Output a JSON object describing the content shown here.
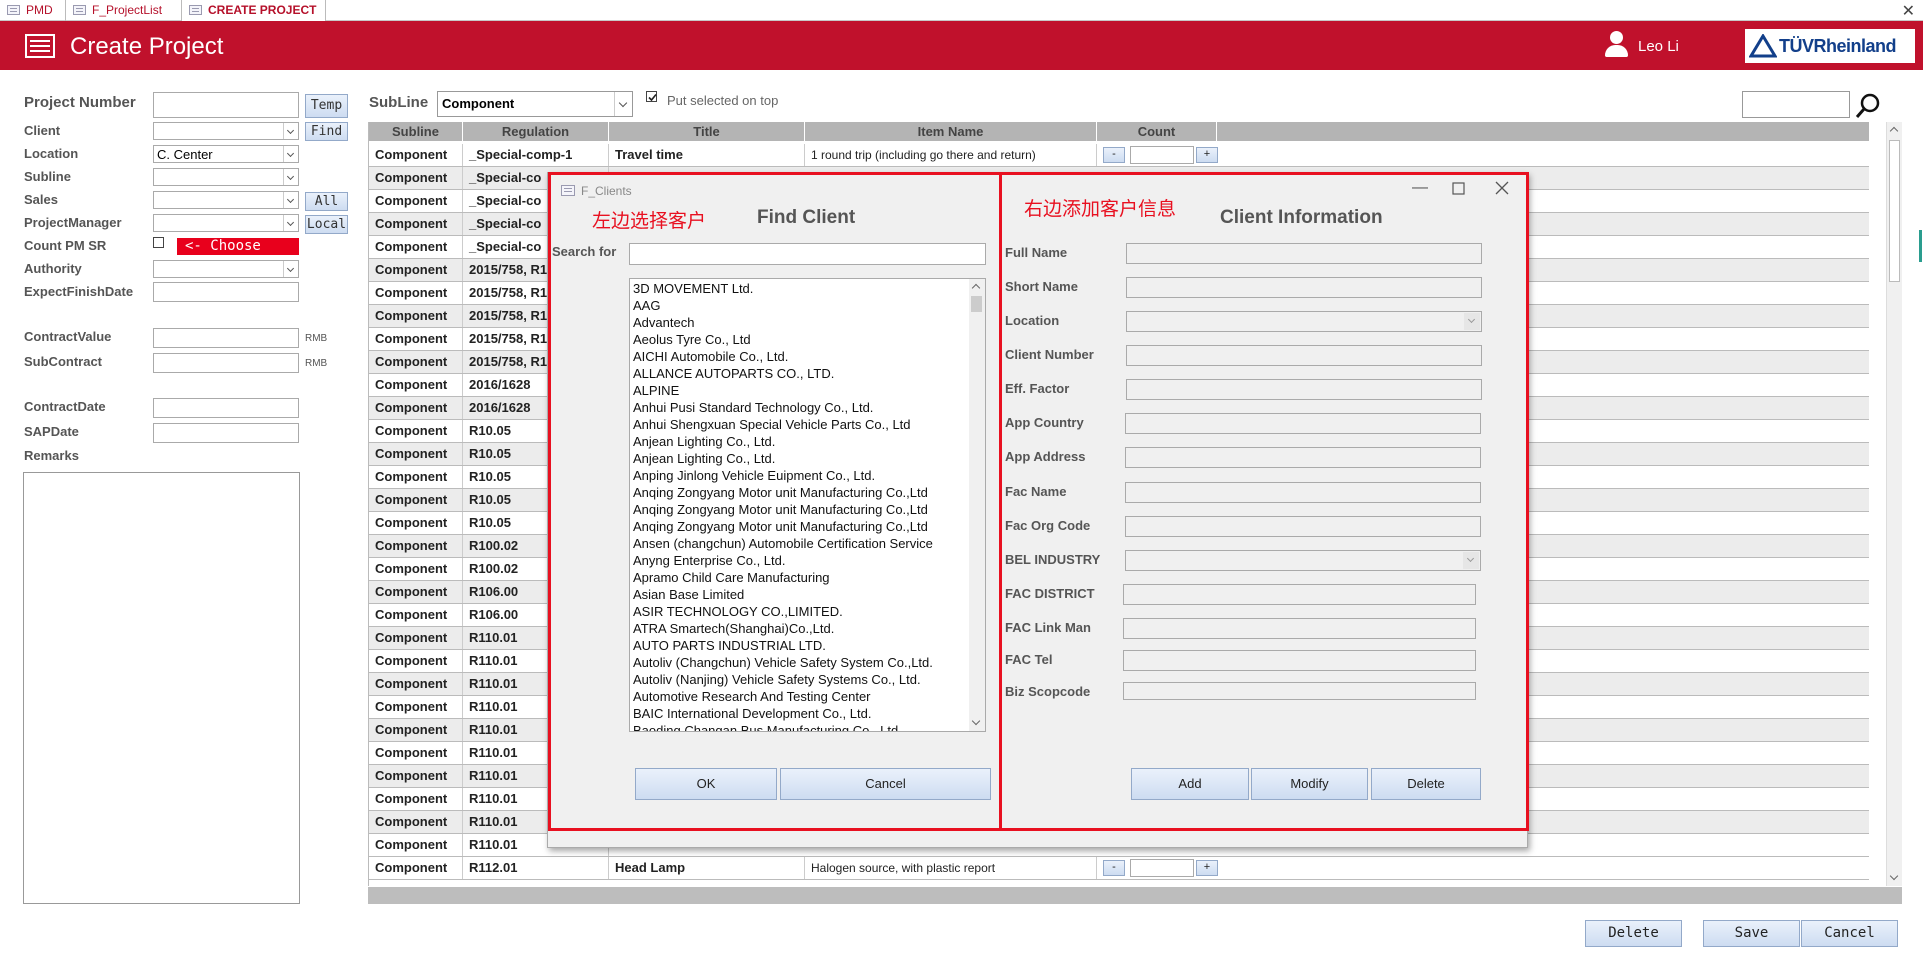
{
  "tabs": [
    {
      "label": "PMD"
    },
    {
      "label": "F_ProjectList"
    },
    {
      "label": "CREATE PROJECT"
    }
  ],
  "window": {
    "close_glyph": "✕"
  },
  "header": {
    "title": "Create Project",
    "user_name": "Leo Li",
    "logo_text": "TÜVRheinland"
  },
  "form": {
    "project_number_label": "Project Number",
    "client_label": "Client",
    "location_label": "Location",
    "location_value": "C. Center",
    "subline_label": "Subline",
    "sales_label": "Sales",
    "project_manager_label": "ProjectManager",
    "count_pm_sr_label": "Count PM SR",
    "authority_label": "Authority",
    "expect_finish_date_label": "ExpectFinishDate",
    "contract_value_label": "ContractValue",
    "subcontract_label": "SubContract",
    "currency": "RMB",
    "contract_date_label": "ContractDate",
    "sap_date_label": "SAPDate",
    "remarks_label": "Remarks",
    "temp_button": "Temp",
    "find_button": "Find",
    "all_button": "All",
    "local_button": "Local",
    "choose_button": "<- Choose"
  },
  "toolbar": {
    "subline_label": "SubLine",
    "subline_value": "Component",
    "put_selected_label": "Put selected on top"
  },
  "grid": {
    "columns": [
      "Subline",
      "Regulation",
      "Title",
      "Item Name",
      "Count"
    ],
    "first_row": [
      "Component",
      "_Special-comp-1",
      "Travel time",
      "1 round trip (including go there and return)"
    ],
    "left_rows": [
      [
        "Component",
        "_Special-co"
      ],
      [
        "Component",
        "_Special-co"
      ],
      [
        "Component",
        "_Special-co"
      ],
      [
        "Component",
        "_Special-co"
      ],
      [
        "Component",
        "2015/758, R1"
      ],
      [
        "Component",
        "2015/758, R1"
      ],
      [
        "Component",
        "2015/758, R1"
      ],
      [
        "Component",
        "2015/758, R1"
      ],
      [
        "Component",
        "2015/758, R1"
      ],
      [
        "Component",
        "2016/1628"
      ],
      [
        "Component",
        "2016/1628"
      ],
      [
        "Component",
        "R10.05"
      ],
      [
        "Component",
        "R10.05"
      ],
      [
        "Component",
        "R10.05"
      ],
      [
        "Component",
        "R10.05"
      ],
      [
        "Component",
        "R10.05"
      ],
      [
        "Component",
        "R100.02"
      ],
      [
        "Component",
        "R100.02"
      ],
      [
        "Component",
        "R106.00"
      ],
      [
        "Component",
        "R106.00"
      ],
      [
        "Component",
        "R110.01"
      ],
      [
        "Component",
        "R110.01"
      ],
      [
        "Component",
        "R110.01"
      ],
      [
        "Component",
        "R110.01"
      ],
      [
        "Component",
        "R110.01"
      ],
      [
        "Component",
        "R110.01"
      ],
      [
        "Component",
        "R110.01"
      ],
      [
        "Component",
        "R110.01"
      ],
      [
        "Component",
        "R110.01"
      ],
      [
        "Component",
        "R110.01"
      ]
    ],
    "last_row": [
      "Component",
      "R112.01",
      "Head Lamp",
      "Halogen source, with plastic report"
    ]
  },
  "bottom_buttons": {
    "delete": "Delete",
    "save": "Save",
    "cancel": "Cancel"
  },
  "dialog": {
    "title": "F_Clients",
    "annotation_left": "左边选择客户",
    "annotation_right": "右边添加客户信息",
    "find_heading": "Find Client",
    "info_heading": "Client Information",
    "search_label": "Search for",
    "clients": [
      "3D MOVEMENT Ltd.",
      "AAG",
      "Advantech",
      "Aeolus Tyre Co., Ltd",
      "AICHI Automobile Co., Ltd.",
      "ALLANCE AUTOPARTS CO., LTD.",
      "ALPINE",
      "Anhui Pusi Standard Technology Co., Ltd.",
      "Anhui Shengxuan Special Vehicle Parts Co., Ltd",
      "Anjean Lighting Co., Ltd.",
      "Anjean Lighting Co., Ltd.",
      "Anping Jinlong Vehicle Euipment Co., Ltd.",
      "Anqing Zongyang Motor unit Manufacturing Co.,Ltd",
      "Anqing Zongyang Motor unit Manufacturing Co.,Ltd",
      "Anqing Zongyang Motor unit Manufacturing Co.,Ltd",
      "Ansen (changchun) Automobile Certification Service",
      "Anyng Enterprise Co., Ltd.",
      "Apramo Child Care Manufacturing",
      "Asian Base Limited",
      "ASIR TECHNOLOGY CO.,LIMITED.",
      "ATRA Smartech(Shanghai)Co.,Ltd.",
      "AUTO PARTS INDUSTRIAL LTD.",
      "Autoliv (Changchun) Vehicle Safety System Co.,Ltd.",
      "Autoliv (Nanjing) Vehicle Safety Systems Co., Ltd.",
      "Automotive Research And Testing Center",
      "BAIC International Development Co., Ltd.",
      "Baoding Changan Bus Manufacturing Co., Ltd"
    ],
    "fields": [
      {
        "label": "Full Name"
      },
      {
        "label": "Short Name"
      },
      {
        "label": "Location"
      },
      {
        "label": "Client Number"
      },
      {
        "label": "Eff. Factor"
      },
      {
        "label": "App Country"
      },
      {
        "label": "App Address"
      },
      {
        "label": "Fac Name"
      },
      {
        "label": "Fac Org Code"
      },
      {
        "label": "BEL INDUSTRY"
      },
      {
        "label": "FAC DISTRICT"
      },
      {
        "label": "FAC Link Man"
      },
      {
        "label": "FAC Tel"
      },
      {
        "label": "Biz Scopcode"
      }
    ],
    "ok_button": "OK",
    "cancel_button": "Cancel",
    "add_button": "Add",
    "modify_button": "Modify",
    "delete_button": "Delete"
  }
}
